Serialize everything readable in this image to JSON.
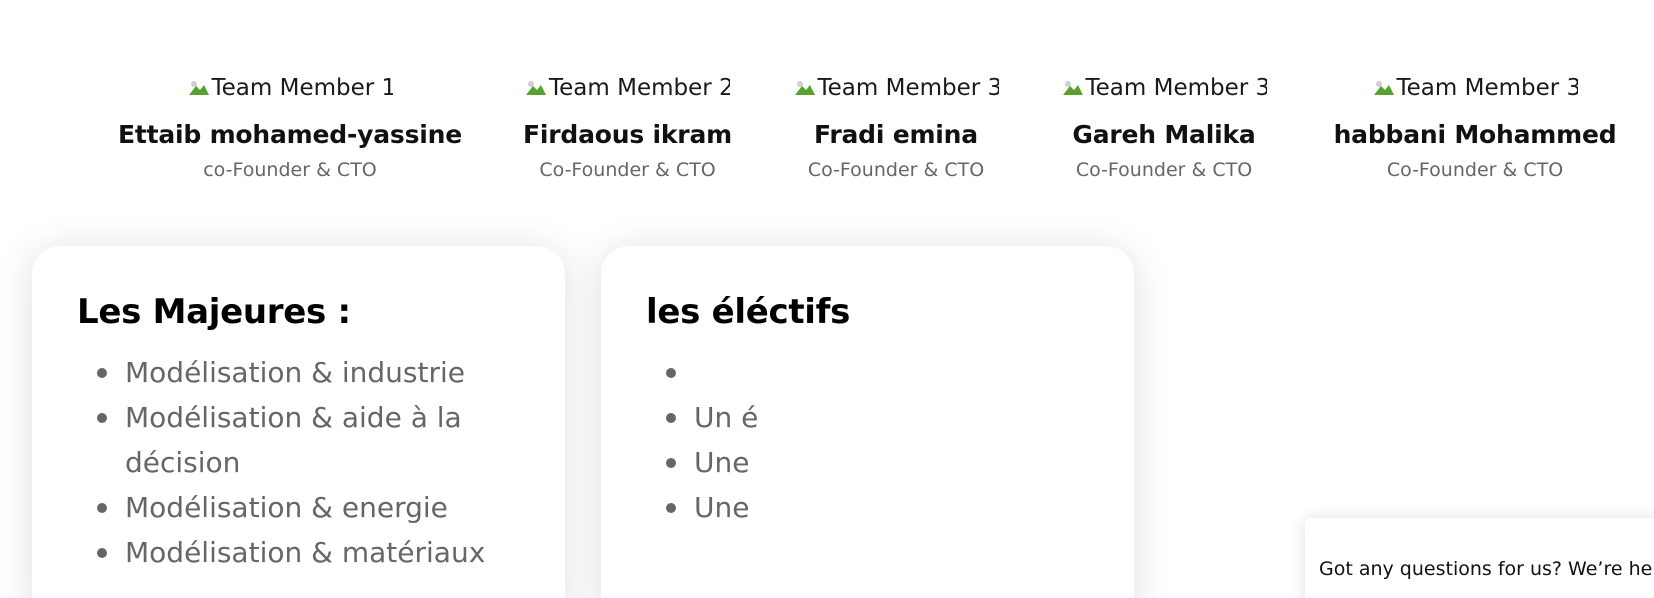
{
  "team": {
    "members": [
      {
        "photo_alt": "Team Member 1",
        "name": "Ettaib mohamed-yassine",
        "role": "co-Founder & CTO"
      },
      {
        "photo_alt": "Team Member 2",
        "name": "Firdaous ikram",
        "role": "Co-Founder & CTO"
      },
      {
        "photo_alt": "Team Member 3",
        "name": "Fradi emina",
        "role": "Co-Founder & CTO"
      },
      {
        "photo_alt": "Team Member 3",
        "name": "Gareh Malika",
        "role": "Co-Founder & CTO"
      },
      {
        "photo_alt": "Team Member 3",
        "name": "habbani Mohammed",
        "role": "Co-Founder & CTO"
      }
    ]
  },
  "majeures": {
    "title": "Les Majeures :",
    "items": [
      "Modélisation & industrie",
      "Modélisation & aide à la décision",
      "Modélisation & energie",
      "Modélisation & matériaux"
    ]
  },
  "electifs": {
    "title": "les éléctifs",
    "items": [
      "",
      "Un é",
      "Une",
      "Une"
    ]
  },
  "chat": {
    "message": "Got any questions for us? We’re here"
  },
  "colors": {
    "text_muted": "#666666",
    "heading": "#000000",
    "card_bg": "#ffffff"
  }
}
